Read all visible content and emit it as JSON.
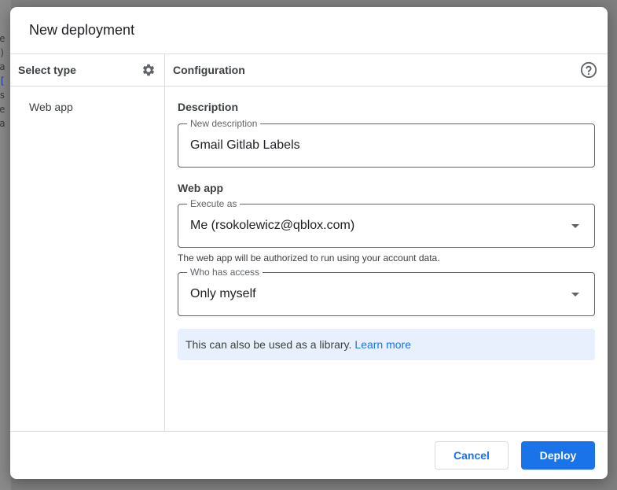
{
  "dialog": {
    "title": "New deployment"
  },
  "left_pane": {
    "header": "Select type",
    "settings_icon": "gear-icon",
    "items": [
      {
        "label": "Web app"
      }
    ]
  },
  "right_pane": {
    "header": "Configuration",
    "help_icon": "help-circle-icon",
    "description_section": "Description",
    "description_field": {
      "legend": "New description",
      "value": "Gmail Gitlab Labels"
    },
    "webapp_section": "Web app",
    "execute_as": {
      "legend": "Execute as",
      "value": "Me (rsokolewicz@qblox.com)"
    },
    "execute_hint": "The web app will be authorized to run using your account data.",
    "who_has_access": {
      "legend": "Who has access",
      "value": "Only myself"
    },
    "library_info": {
      "text": "This can also be used as a library.",
      "link": "Learn more"
    }
  },
  "footer": {
    "cancel_label": "Cancel",
    "deploy_label": "Deploy"
  },
  "colors": {
    "accent": "#1a73e8",
    "info_bg": "#e8f0fe",
    "overlay": "#7f7f7f"
  }
}
